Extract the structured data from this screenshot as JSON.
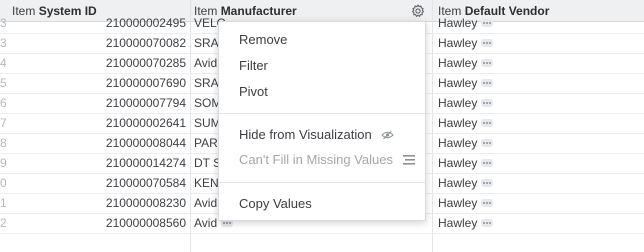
{
  "header": {
    "columns": [
      {
        "prefix": "Item",
        "field": "System ID"
      },
      {
        "prefix": "Item",
        "field": "Manufacturer"
      },
      {
        "prefix": "Item",
        "field": "Default Vendor"
      }
    ]
  },
  "rows": [
    {
      "num": "3",
      "system_id": "210000002495",
      "manufacturer": "VELO",
      "vendor": "Hawley"
    },
    {
      "num": "3",
      "system_id": "210000070082",
      "manufacturer": "SRAM",
      "vendor": "Hawley"
    },
    {
      "num": "4",
      "system_id": "210000070285",
      "manufacturer": "Avid",
      "vendor": "Hawley"
    },
    {
      "num": "5",
      "system_id": "210000007690",
      "manufacturer": "SRAM",
      "vendor": "Hawley"
    },
    {
      "num": "6",
      "system_id": "210000007794",
      "manufacturer": "SOM",
      "vendor": "Hawley"
    },
    {
      "num": "7",
      "system_id": "210000002641",
      "manufacturer": "SUM",
      "vendor": "Hawley"
    },
    {
      "num": "8",
      "system_id": "210000008044",
      "manufacturer": "PARK",
      "vendor": "Hawley"
    },
    {
      "num": "9",
      "system_id": "210000014274",
      "manufacturer": "DT S",
      "vendor": "Hawley"
    },
    {
      "num": "0",
      "system_id": "210000070584",
      "manufacturer": "KENI",
      "vendor": "Hawley"
    },
    {
      "num": "1",
      "system_id": "210000008230",
      "manufacturer": "Avid",
      "vendor": "Hawley"
    },
    {
      "num": "2",
      "system_id": "210000008560",
      "manufacturer": "Avid",
      "vendor": "Hawley"
    }
  ],
  "menu": {
    "remove": "Remove",
    "filter": "Filter",
    "pivot": "Pivot",
    "hide": "Hide from Visualization",
    "fill_missing": "Can't Fill in Missing Values",
    "copy": "Copy Values"
  },
  "icons": {
    "gear": "gear-icon",
    "hide": "eye-slash-icon",
    "fill": "fill-lines-icon",
    "more": "ellipsis-icon"
  },
  "colors": {
    "header_bg": "#eef0f2",
    "text": "#3c3e42",
    "disabled_text": "#a3a7ac"
  }
}
